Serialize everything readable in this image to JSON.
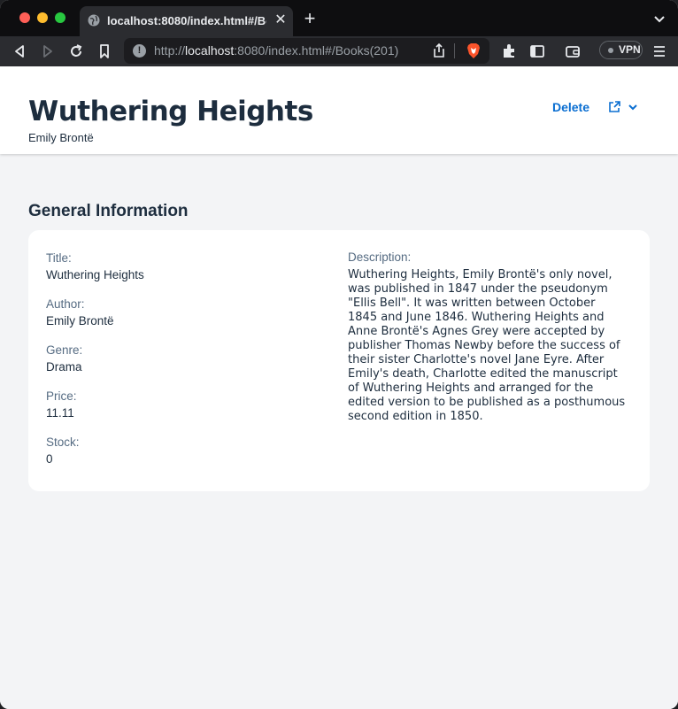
{
  "browser": {
    "tab": {
      "title": "localhost:8080/index.html#/Books(201)",
      "close_glyph": "✕",
      "favicon": "globe-icon"
    },
    "new_tab_glyph": "+",
    "url": {
      "scheme": "http://",
      "host": "localhost",
      "rest": ":8080/index.html#/Books(201)"
    },
    "vpn_label": "VPN"
  },
  "object": {
    "title": "Wuthering Heights",
    "subtitle": "Emily Brontë",
    "actions": {
      "delete_label": "Delete"
    }
  },
  "section": {
    "title": "General Information",
    "fields": [
      {
        "label": "Title:",
        "value": "Wuthering Heights"
      },
      {
        "label": "Author:",
        "value": "Emily Brontë"
      },
      {
        "label": "Genre:",
        "value": "Drama"
      },
      {
        "label": "Price:",
        "value": "11.11"
      },
      {
        "label": "Stock:",
        "value": "0"
      }
    ],
    "description": {
      "label": "Description:",
      "value": "Wuthering Heights, Emily Brontë's only novel, was published in 1847 under the pseudonym \"Ellis Bell\". It was written between October 1845 and June 1846. Wuthering Heights and Anne Brontë's Agnes Grey were accepted by publisher Thomas Newby before the success of their sister Charlotte's novel Jane Eyre. After Emily's death, Charlotte edited the manuscript of Wuthering Heights and arranged for the edited version to be published as a posthumous second edition in 1850."
    }
  },
  "colors": {
    "accent": "#0a6ed1",
    "title_text": "#1d2d3e",
    "label_text": "#556b82",
    "page_bg": "#f3f4f6"
  }
}
